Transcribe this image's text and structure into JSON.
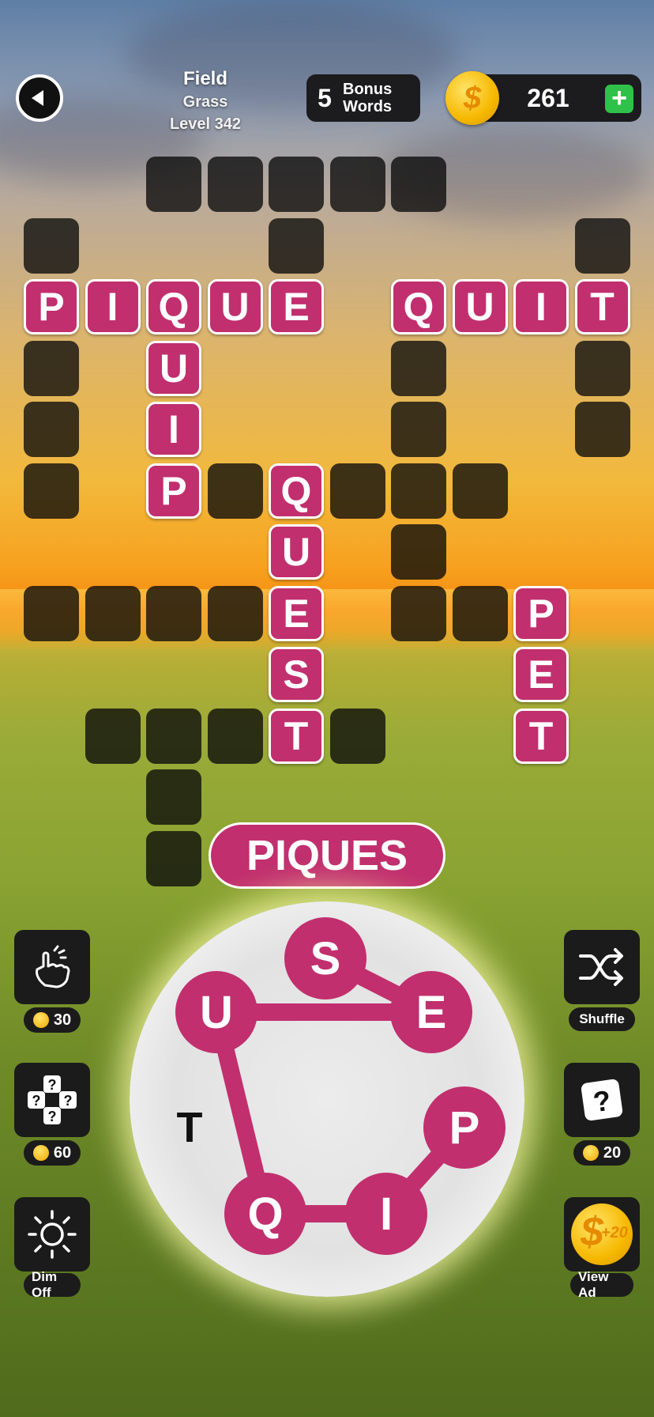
{
  "header": {
    "category": "Field",
    "subcategory": "Grass",
    "level": "Level 342",
    "bonus_count": "5",
    "bonus_label_1": "Bonus",
    "bonus_label_2": "Words",
    "coins": "261",
    "coin_symbol": "$",
    "add_symbol": "+"
  },
  "board": {
    "rows": [
      {
        "row": 0,
        "cells": [
          {
            "c": 2
          },
          {
            "c": 3
          },
          {
            "c": 4
          },
          {
            "c": 5
          },
          {
            "c": 6
          }
        ]
      },
      {
        "row": 1,
        "cells": [
          {
            "c": 0
          },
          {
            "c": 4
          },
          {
            "c": 9
          }
        ]
      },
      {
        "row": 2,
        "cells": [
          {
            "c": 0,
            "l": "P"
          },
          {
            "c": 1,
            "l": "I"
          },
          {
            "c": 2,
            "l": "Q"
          },
          {
            "c": 3,
            "l": "U"
          },
          {
            "c": 4,
            "l": "E"
          },
          {
            "c": 6,
            "l": "Q"
          },
          {
            "c": 7,
            "l": "U"
          },
          {
            "c": 8,
            "l": "I"
          },
          {
            "c": 9,
            "l": "T"
          }
        ]
      },
      {
        "row": 3,
        "cells": [
          {
            "c": 0
          },
          {
            "c": 2,
            "l": "U"
          },
          {
            "c": 6
          },
          {
            "c": 9
          }
        ]
      },
      {
        "row": 4,
        "cells": [
          {
            "c": 0
          },
          {
            "c": 2,
            "l": "I"
          },
          {
            "c": 6
          },
          {
            "c": 9
          }
        ]
      },
      {
        "row": 5,
        "cells": [
          {
            "c": 0
          },
          {
            "c": 2,
            "l": "P"
          },
          {
            "c": 3
          },
          {
            "c": 4,
            "l": "Q"
          },
          {
            "c": 5
          },
          {
            "c": 6
          },
          {
            "c": 7
          }
        ]
      },
      {
        "row": 6,
        "cells": [
          {
            "c": 4,
            "l": "U"
          },
          {
            "c": 6
          }
        ]
      },
      {
        "row": 7,
        "cells": [
          {
            "c": 0
          },
          {
            "c": 1
          },
          {
            "c": 2
          },
          {
            "c": 3
          },
          {
            "c": 4,
            "l": "E"
          },
          {
            "c": 6
          },
          {
            "c": 7
          },
          {
            "c": 8,
            "l": "P"
          }
        ]
      },
      {
        "row": 8,
        "cells": [
          {
            "c": 4,
            "l": "S"
          },
          {
            "c": 8,
            "l": "E"
          }
        ]
      },
      {
        "row": 9,
        "cells": [
          {
            "c": 1
          },
          {
            "c": 2
          },
          {
            "c": 3
          },
          {
            "c": 4,
            "l": "T"
          },
          {
            "c": 5
          },
          {
            "c": 8,
            "l": "T"
          }
        ]
      },
      {
        "row": 10,
        "cells": [
          {
            "c": 2
          }
        ]
      },
      {
        "row": 11,
        "cells": [
          {
            "c": 2
          }
        ]
      }
    ]
  },
  "current_word": "PIQUES",
  "wheel": {
    "letters": [
      "S",
      "E",
      "P",
      "I",
      "Q",
      "U",
      "T"
    ],
    "path_order": [
      "P",
      "I",
      "Q",
      "U",
      "E",
      "S"
    ]
  },
  "powerups": {
    "left": [
      {
        "icon": "pointing-hand-icon",
        "cost": "30"
      },
      {
        "icon": "question-dice-icon",
        "cost": "60"
      },
      {
        "icon": "sun-icon",
        "label": "Dim Off"
      }
    ],
    "right": [
      {
        "icon": "shuffle-icon",
        "label": "Shuffle"
      },
      {
        "icon": "question-card-icon",
        "cost": "20"
      },
      {
        "icon": "coin-plus-20-icon",
        "label": "View Ad",
        "badge": "+20"
      }
    ]
  },
  "colors": {
    "tile_filled": "#c12f6e",
    "tile_empty": "#141414",
    "coin": "#f6b800",
    "plus_button": "#2ec24a"
  }
}
